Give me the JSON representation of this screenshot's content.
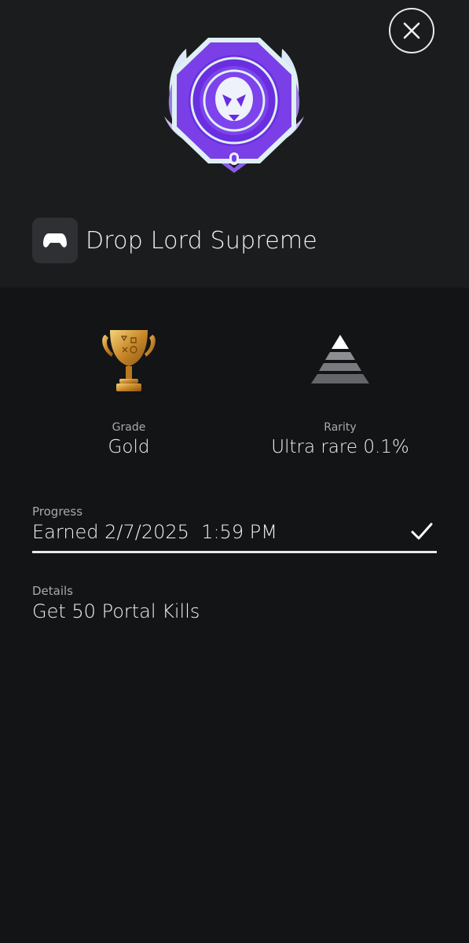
{
  "trophy": {
    "name": "Drop Lord Supreme",
    "platform_icon": "gamepad-icon",
    "badge_colors": {
      "primary": "#7b3fe8",
      "rim": "#dff0f4",
      "glow": "#b9a6f0"
    }
  },
  "grade": {
    "label": "Grade",
    "value": "Gold",
    "icon": "gold-trophy-icon"
  },
  "rarity": {
    "label": "Rarity",
    "value": "Ultra rare 0.1%",
    "icon": "rarity-pyramid-icon"
  },
  "progress": {
    "label": "Progress",
    "value": "Earned 2/7/2025  1:59 PM",
    "status_icon": "checkmark-icon",
    "fraction": 1.0
  },
  "details": {
    "label": "Details",
    "value": "Get 50 Portal Kills"
  },
  "actions": {
    "close_icon": "close-icon"
  }
}
